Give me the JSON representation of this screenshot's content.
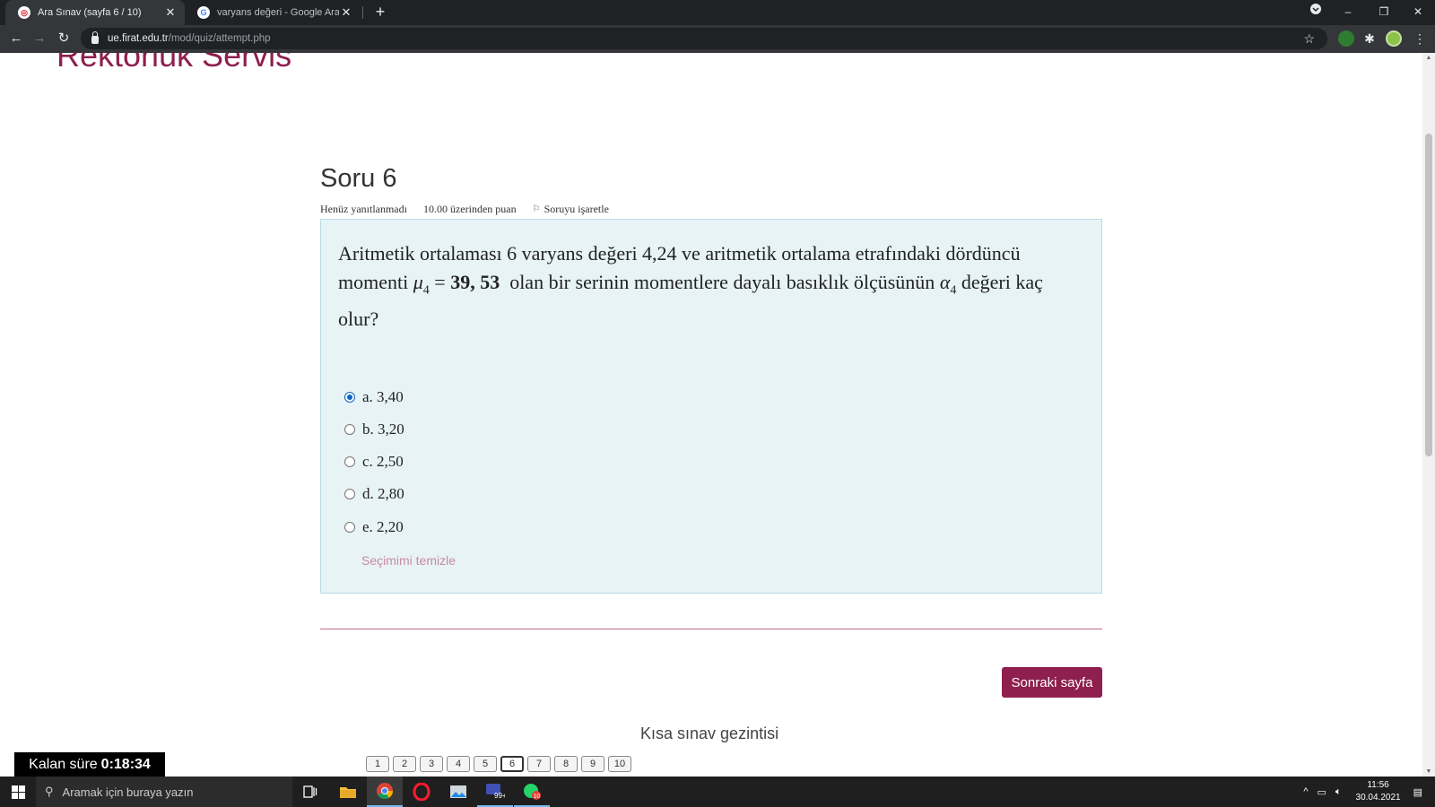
{
  "browser": {
    "tabs": [
      {
        "title": "Ara Sınav (sayfa 6 / 10)",
        "active": true
      },
      {
        "title": "varyans değeri - Google Arama",
        "active": false
      }
    ],
    "url_host": "ue.firat.edu.tr",
    "url_path": "/mod/quiz/attempt.php",
    "new_tab_symbol": "+",
    "close_symbol": "✕"
  },
  "site": {
    "brand": "Rektörlük Servis"
  },
  "question": {
    "title": "Soru 6",
    "status": "Henüz yanıtlanmadı",
    "grade": "10.00 üzerinden puan",
    "flag_label": "Soruyu işaretle",
    "text_part1": "Aritmetik ortalaması 6 varyans değeri 4,24 ve aritmetik ortalama etrafındaki dördüncü momenti",
    "mu": "μ",
    "mu_sub": "4",
    "equals": "=",
    "mu_value": "39, 53",
    "text_part2": "olan bir serinin momentlere dayalı basıklık ölçüsünün",
    "alpha": "α",
    "alpha_sub": "4",
    "text_part3": "değeri kaç olur?",
    "answers": [
      {
        "label": "a. 3,40",
        "selected": true
      },
      {
        "label": "b. 3,20",
        "selected": false
      },
      {
        "label": "c. 2,50",
        "selected": false
      },
      {
        "label": "d. 2,80",
        "selected": false
      },
      {
        "label": "e. 2,20",
        "selected": false
      }
    ],
    "clear_choice": "Seçimimi temizle"
  },
  "navigation": {
    "next_button": "Sonraki sayfa",
    "heading": "Kısa sınav gezintisi",
    "pages": [
      "1",
      "2",
      "3",
      "4",
      "5",
      "6",
      "7",
      "8",
      "9",
      "10"
    ],
    "current_page": "6"
  },
  "timer": {
    "label": "Kalan süre",
    "value": "0:18:34"
  },
  "taskbar": {
    "search_placeholder": "Aramak için buraya yazın",
    "time": "11:56",
    "date": "30.04.2021",
    "badges": {
      "mail": "99+",
      "whatsapp": "10"
    }
  },
  "colors": {
    "brand": "#8e1f4f",
    "question_bg": "#e7f3f5",
    "chrome_dark": "#202124"
  }
}
